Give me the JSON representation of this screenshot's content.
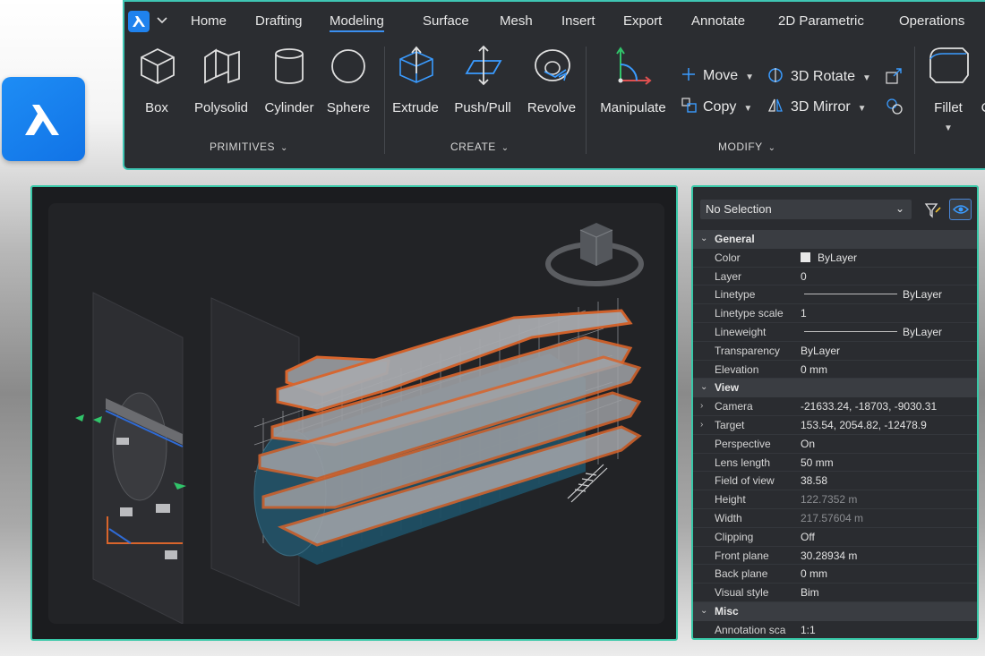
{
  "tabs": [
    {
      "label": "Home"
    },
    {
      "label": "Drafting"
    },
    {
      "label": "Modeling",
      "active": true
    },
    {
      "label": "Surface"
    },
    {
      "label": "Mesh"
    },
    {
      "label": "Insert"
    },
    {
      "label": "Export"
    },
    {
      "label": "Annotate"
    },
    {
      "label": "2D Parametric"
    },
    {
      "label": "Operations"
    }
  ],
  "ribbon": {
    "primitives": {
      "label": "PRIMITIVES",
      "tools": [
        "Box",
        "Polysolid",
        "Cylinder",
        "Sphere"
      ]
    },
    "create": {
      "label": "CREATE",
      "tools": [
        "Extrude",
        "Push/Pull",
        "Revolve"
      ]
    },
    "modify": {
      "label": "MODIFY",
      "manipulate": "Manipulate",
      "move": "Move",
      "copy": "Copy",
      "rotate3d": "3D Rotate",
      "mirror3d": "3D Mirror",
      "fillet": "Fillet",
      "cut_off": "C"
    }
  },
  "properties": {
    "selection": "No Selection",
    "categories": {
      "general": "General",
      "view": "View",
      "misc": "Misc"
    },
    "general": [
      {
        "key": "Color",
        "value": "ByLayer"
      },
      {
        "key": "Layer",
        "value": "0"
      },
      {
        "key": "Linetype",
        "value": "ByLayer"
      },
      {
        "key": "Linetype scale",
        "value": "1"
      },
      {
        "key": "Lineweight",
        "value": "ByLayer"
      },
      {
        "key": "Transparency",
        "value": "ByLayer"
      },
      {
        "key": "Elevation",
        "value": "0 mm"
      }
    ],
    "view": [
      {
        "key": "Camera",
        "value": "-21633.24, -18703, -9030.31"
      },
      {
        "key": "Target",
        "value": "153.54, 2054.82, -12478.9"
      },
      {
        "key": "Perspective",
        "value": "On"
      },
      {
        "key": "Lens length",
        "value": "50 mm"
      },
      {
        "key": "Field of view",
        "value": "38.58"
      },
      {
        "key": "Height",
        "value": "122.7352 m"
      },
      {
        "key": "Width",
        "value": "217.57604 m"
      },
      {
        "key": "Clipping",
        "value": "Off"
      },
      {
        "key": "Front plane",
        "value": "30.28934 m"
      },
      {
        "key": "Back plane",
        "value": "0 mm"
      },
      {
        "key": "Visual style",
        "value": "Bim"
      }
    ],
    "misc": [
      {
        "key": "Annotation sca",
        "value": "1:1"
      }
    ]
  },
  "colors": {
    "accent": "#3b8ff0",
    "frame": "#38c8a8",
    "model_orange": "#d9652c",
    "model_blue": "#1f4f63"
  }
}
